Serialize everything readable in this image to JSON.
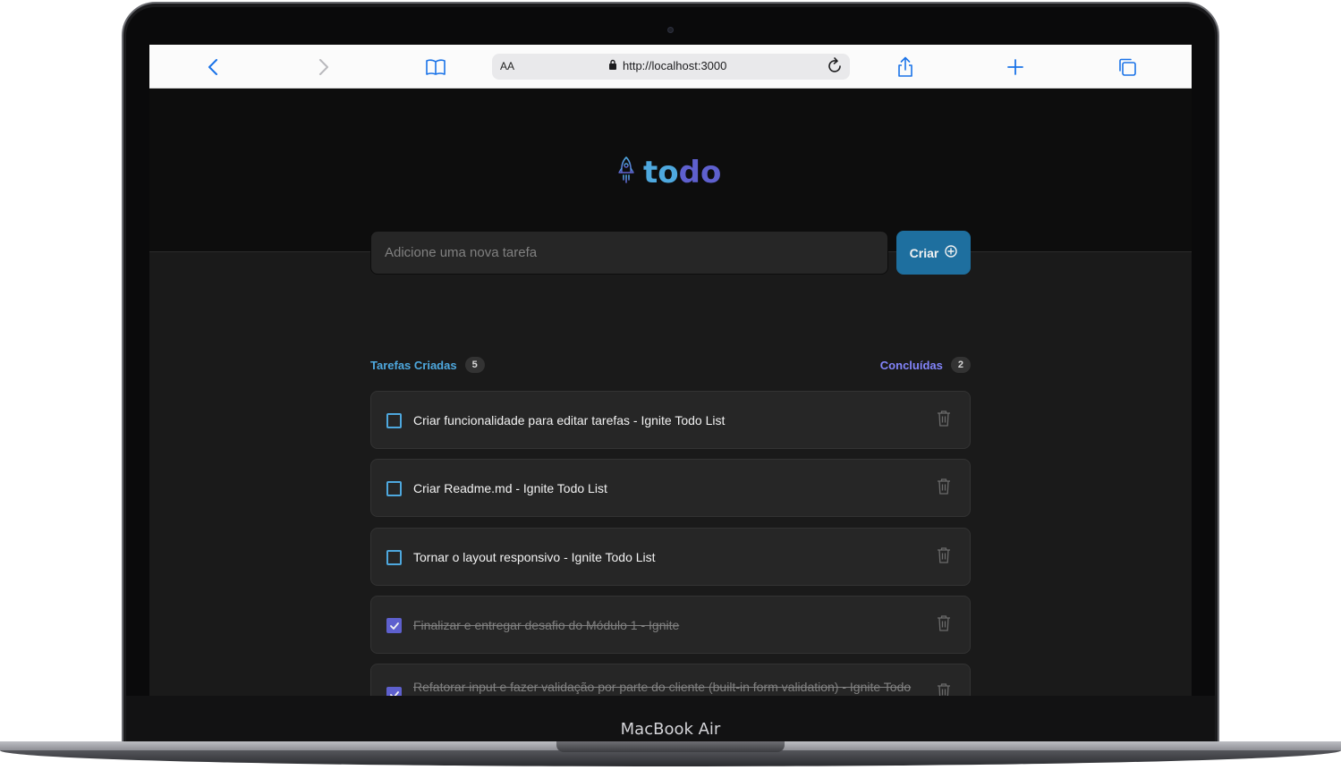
{
  "device": {
    "model_name": "MacBook Air"
  },
  "browser": {
    "text_size_label": "AA",
    "url": "http://localhost:3000",
    "icons": [
      "back-icon",
      "forward-icon",
      "bookmarks-icon",
      "lock-icon",
      "reload-icon",
      "share-icon",
      "new-tab-icon",
      "tabs-icon"
    ]
  },
  "app": {
    "logo": {
      "part1": "to",
      "part2": "do",
      "icon": "rocket-icon"
    },
    "new_task": {
      "placeholder": "Adicione uma nova tarefa",
      "value": ""
    },
    "create_button": {
      "label": "Criar",
      "icon": "plus-circle-icon"
    },
    "counters": {
      "created_label": "Tarefas Criadas",
      "created_count": "5",
      "done_label": "Concluídas",
      "done_count": "2"
    },
    "tasks": [
      {
        "text": "Criar funcionalidade para editar tarefas - Ignite Todo List",
        "done": false
      },
      {
        "text": "Criar Readme.md - Ignite Todo List",
        "done": false
      },
      {
        "text": "Tornar o layout responsivo - Ignite Todo List",
        "done": false
      },
      {
        "text": "Finalizar e entregar desafio do Módulo 1 - Ignite",
        "done": true
      },
      {
        "text": "Refatorar input e fazer validação por parte do cliente (built-in form validation) - Ignite Todo",
        "done": true
      }
    ],
    "colors": {
      "blue": "#4ea8de",
      "purple": "#5e60ce",
      "purple_light": "#8284fa",
      "button": "#1e6f9f",
      "background": "#1a1a1a",
      "header": "#0d0d0d",
      "card": "#262626"
    }
  }
}
